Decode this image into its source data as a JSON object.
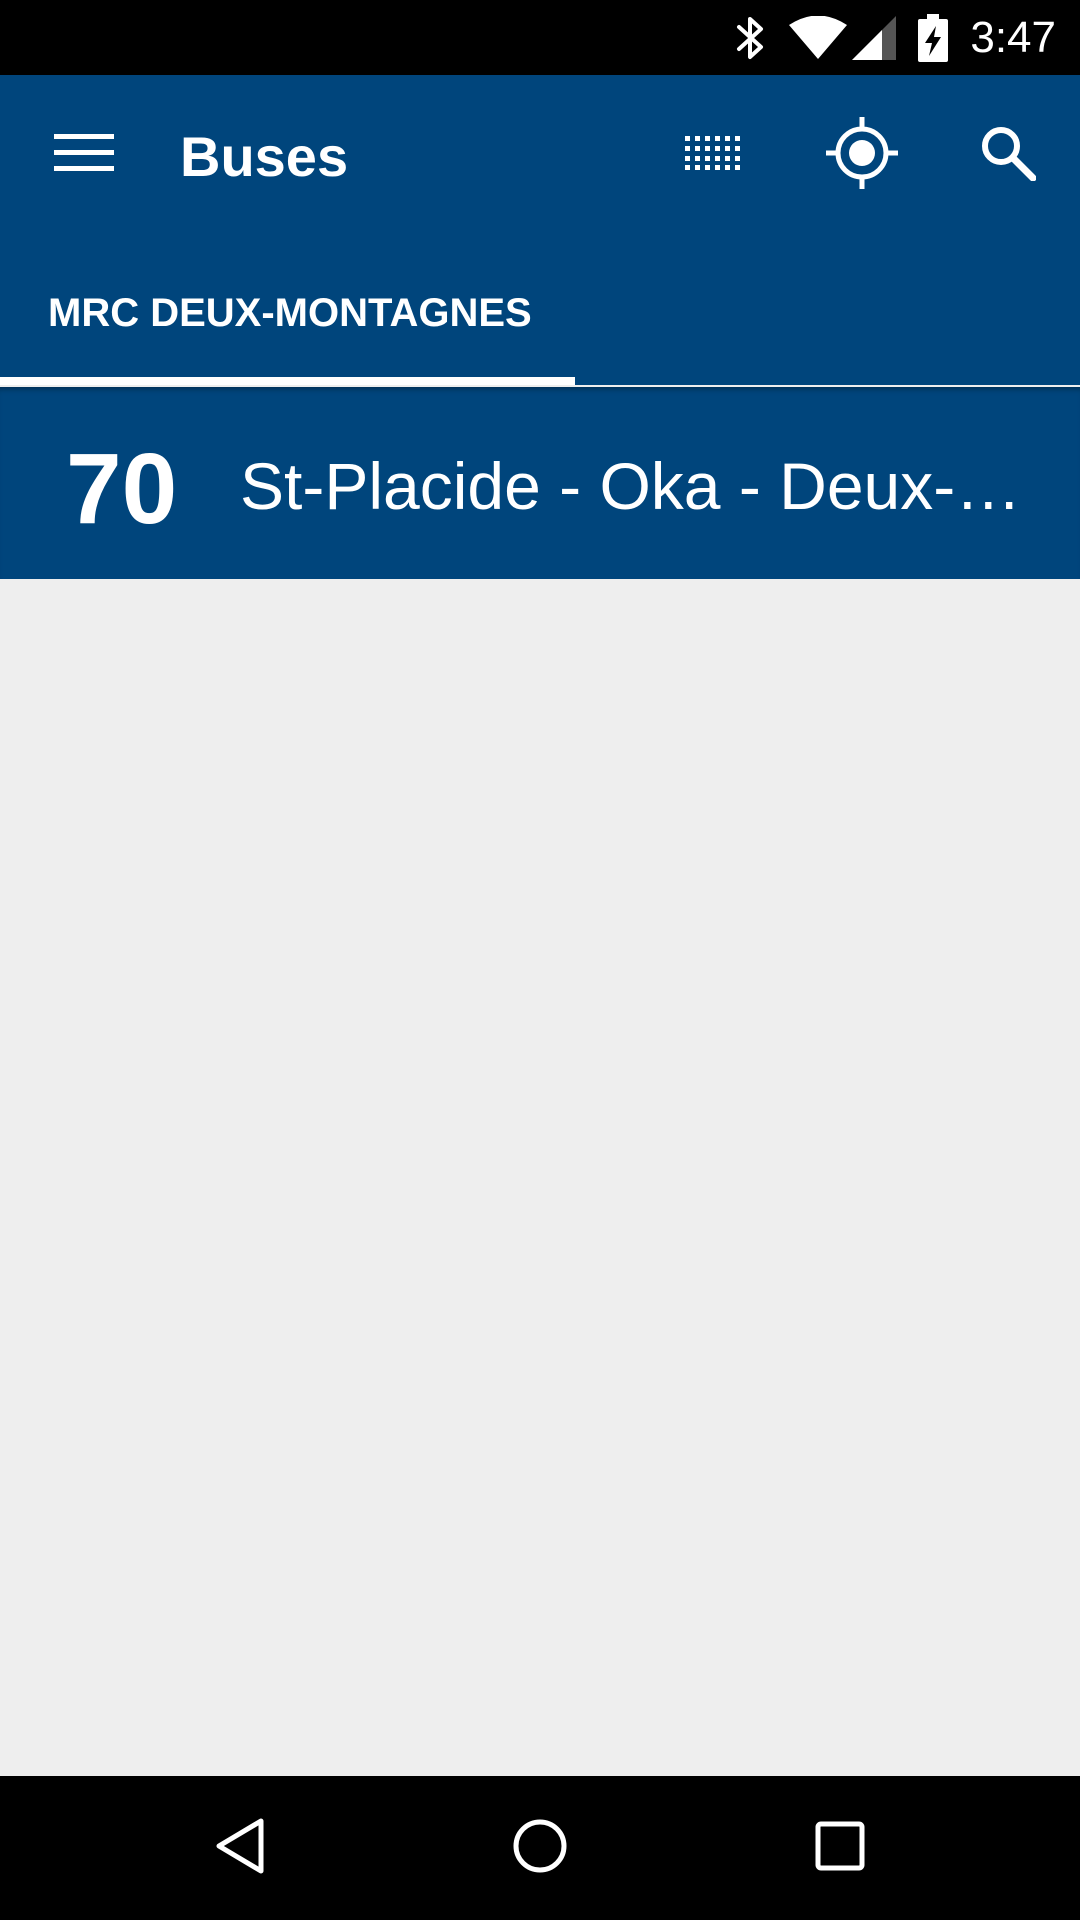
{
  "status_bar": {
    "time": "3:47",
    "icons": [
      "bluetooth-icon",
      "wifi-icon",
      "signal-icon",
      "battery-charging-icon"
    ]
  },
  "app_bar": {
    "title": "Buses",
    "icons": [
      "menu-icon",
      "grid-icon",
      "my-location-icon",
      "search-icon"
    ]
  },
  "tabs": [
    {
      "label": "MRC DEUX-MONTAGNES",
      "selected": true
    }
  ],
  "routes": [
    {
      "number": "70",
      "name": "St-Placide - Oka - Deux-Montagnes"
    }
  ],
  "nav_bar": {
    "icons": [
      "back-icon",
      "home-icon",
      "recents-icon"
    ]
  },
  "colors": {
    "primary": "#00457c",
    "background": "#eeeeee",
    "system_bars": "#000000",
    "text_on_primary": "#ffffff"
  }
}
